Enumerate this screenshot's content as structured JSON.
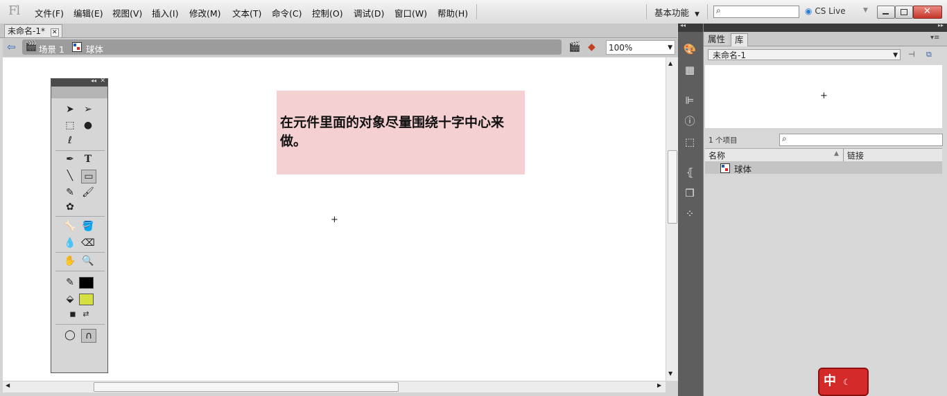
{
  "app": {
    "logo": "Fl",
    "workspace": "基本功能",
    "cs_live": "CS Live"
  },
  "menu": [
    "文件(F)",
    "编辑(E)",
    "视图(V)",
    "插入(I)",
    "修改(M)",
    "文本(T)",
    "命令(C)",
    "控制(O)",
    "调试(D)",
    "窗口(W)",
    "帮助(H)"
  ],
  "document": {
    "tab_title": "未命名-1*"
  },
  "breadcrumb": {
    "scene": "场景 1",
    "symbol": "球体"
  },
  "zoom": {
    "value": "100%"
  },
  "stage": {
    "note_text": "在元件里面的对象尽量围绕十字中心来做。",
    "note_color": "#f5d0d2"
  },
  "tools": {
    "stroke_color": "#000000",
    "fill_color": "#d4e040"
  },
  "panel": {
    "tabs": [
      "属性",
      "库"
    ],
    "library_select": "未命名-1",
    "item_count": "1 个项目",
    "columns": {
      "name": "名称",
      "linkage": "链接"
    },
    "items": [
      {
        "name": "球体",
        "icon": "movieclip-symbol-icon"
      }
    ]
  },
  "badge": {
    "text": "中"
  }
}
